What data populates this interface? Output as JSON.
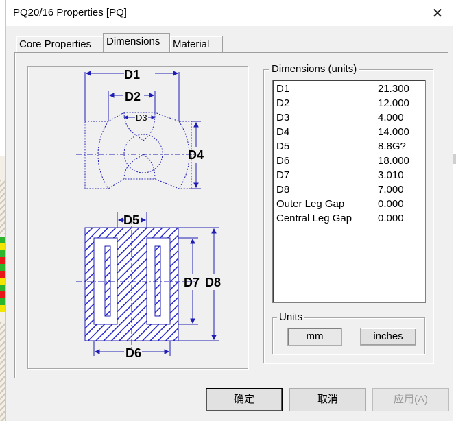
{
  "window": {
    "title": "PQ20/16 Properties [PQ]",
    "close_icon": "close-icon"
  },
  "tabs": [
    {
      "label": "Core Properties",
      "active": false
    },
    {
      "label": "Dimensions",
      "active": true
    },
    {
      "label": "Material",
      "active": false
    }
  ],
  "drawing": {
    "labels": {
      "d1": "D1",
      "d2": "D2",
      "d3": "D3",
      "d4": "D4",
      "d5": "D5",
      "d6": "D6",
      "d7": "D7",
      "d8": "D8"
    }
  },
  "dimensions_group": {
    "label": "Dimensions (units)",
    "rows": [
      {
        "name": "D1",
        "value": "21.300"
      },
      {
        "name": "D2",
        "value": "12.000"
      },
      {
        "name": "D3",
        "value": "4.000"
      },
      {
        "name": "D4",
        "value": "14.000"
      },
      {
        "name": "D5",
        "value": "8.8G?"
      },
      {
        "name": "D6",
        "value": "18.000"
      },
      {
        "name": "D7",
        "value": "3.010"
      },
      {
        "name": "D8",
        "value": "7.000"
      },
      {
        "name": "Outer Leg Gap",
        "value": "0.000"
      },
      {
        "name": "Central Leg Gap",
        "value": "0.000"
      }
    ]
  },
  "units_group": {
    "label": "Units",
    "mm_label": "mm",
    "inches_label": "inches",
    "selected": "mm"
  },
  "footer": {
    "ok_label": "确定",
    "cancel_label": "取消",
    "apply_label": "应用(A)",
    "apply_enabled": false
  },
  "colors": {
    "drawing_line": "#1e1eb4",
    "hatch": "#2828c8",
    "dialog_bg": "#f0f0f0"
  }
}
